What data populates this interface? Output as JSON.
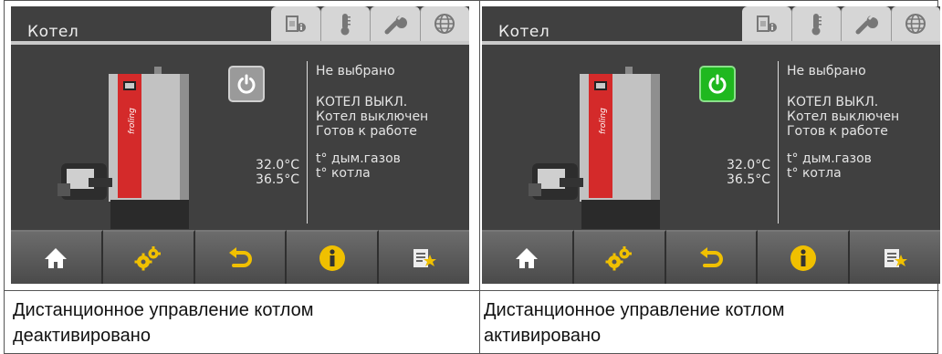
{
  "screens": [
    {
      "title": "Котел",
      "power_state": "off",
      "temps": {
        "flue": "32.0°C",
        "boiler": "36.5°C"
      },
      "info": {
        "line1": "Не выбрано",
        "line2": "КОТЕЛ ВЫКЛ.",
        "line3": "Котел выключен",
        "line4": "Готов к работе",
        "line5": "t° дым.газов",
        "line6": "t° котла"
      },
      "caption": [
        "Дистанционное управление котлом",
        "деактивировано"
      ]
    },
    {
      "title": "Котел",
      "power_state": "on",
      "temps": {
        "flue": "32.0°C",
        "boiler": "36.5°C"
      },
      "info": {
        "line1": "Не выбрано",
        "line2": "КОТЕЛ ВЫКЛ.",
        "line3": "Котел выключен",
        "line4": "Готов к работе",
        "line5": "t° дым.газов",
        "line6": "t° котла"
      },
      "caption": [
        "Дистанционное управление котлом",
        "активировано"
      ]
    }
  ],
  "brand": "froling",
  "icons": {
    "tabs": [
      "boiler-info-icon",
      "thermometer-icon",
      "wrench-icon",
      "globe-icon"
    ],
    "nav": [
      "home-icon",
      "settings-gears-icon",
      "back-arrow-icon",
      "info-icon",
      "favorites-list-icon"
    ]
  },
  "colors": {
    "screen_bg": "#404040",
    "power_on": "#1fb81f",
    "power_off": "#9a9a9a",
    "boiler_red": "#d42a2a"
  }
}
